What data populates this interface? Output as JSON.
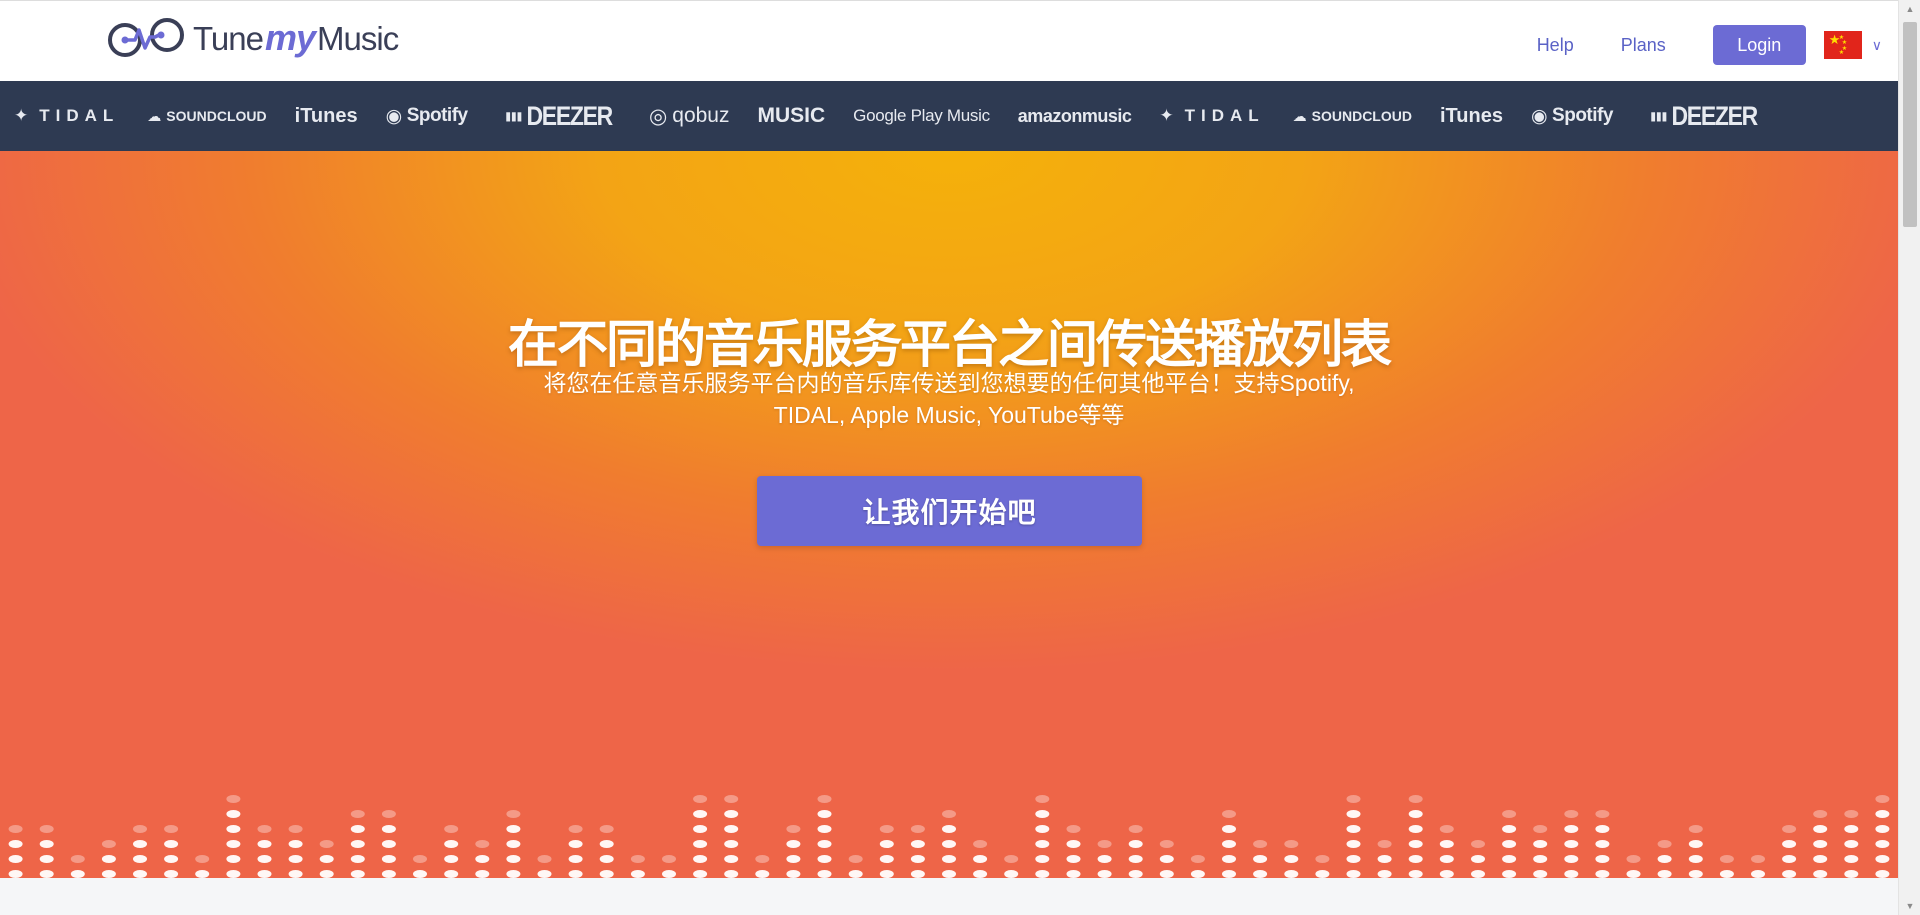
{
  "header": {
    "logo": {
      "tune": "Tune",
      "my": "my",
      "music": "Music"
    },
    "nav": {
      "help": "Help",
      "plans": "Plans",
      "login": "Login"
    },
    "language_flag": "cn-flag-icon"
  },
  "services": [
    {
      "name": "TIDAL",
      "icon": "tidal-icon"
    },
    {
      "name": "SOUNDCLOUD",
      "icon": "soundcloud-icon"
    },
    {
      "name": "iTunes",
      "icon": "apple-icon"
    },
    {
      "name": "Spotify",
      "icon": "spotify-icon"
    },
    {
      "name": "DEEZER",
      "icon": "deezer-icon"
    },
    {
      "name": "qobuz",
      "icon": "qobuz-icon"
    },
    {
      "name": "MUSIC",
      "icon": "apple-icon"
    },
    {
      "name": "Google Play Music",
      "icon": "google-play-icon"
    },
    {
      "name": "amazonmusic",
      "icon": "amazon-icon"
    },
    {
      "name": "TIDAL",
      "icon": "tidal-icon"
    },
    {
      "name": "SOUNDCLOUD",
      "icon": "soundcloud-icon"
    },
    {
      "name": "iTunes",
      "icon": "apple-icon"
    },
    {
      "name": "Spotify",
      "icon": "spotify-icon"
    },
    {
      "name": "DEEZER",
      "icon": "deezer-icon"
    }
  ],
  "hero": {
    "title": "在不同的音乐服务平台之间传送播放列表",
    "subtitle_line1": "将您在任意音乐服务平台内的音乐库传送到您想要的任何其他平台！支持Spotify,",
    "subtitle_line2": "TIDAL, Apple Music, YouTube等等",
    "cta": "让我们开始吧"
  },
  "colors": {
    "brand": "#6c6bd4",
    "strip_bg": "#2e3a52",
    "hero_top": "#f5b10a",
    "hero_bottom": "#ee6548"
  }
}
